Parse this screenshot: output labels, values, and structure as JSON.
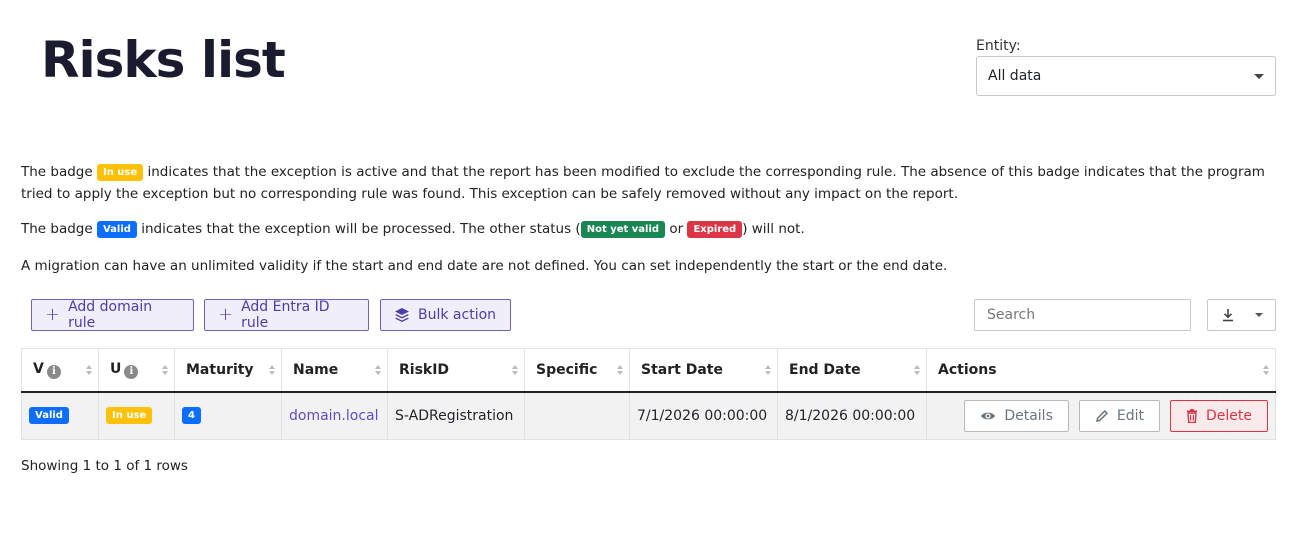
{
  "page": {
    "title": "Risks list"
  },
  "entity": {
    "label": "Entity:",
    "value": "All data"
  },
  "info": {
    "p1_a": "The badge",
    "p1_badge": "In use",
    "p1_b": "indicates that the exception is active and that the report has been modified to exclude the corresponding rule. The absence of this badge indicates that the program tried to apply the exception but no corresponding rule was found. This exception can be safely removed without any impact on the report.",
    "p2_a": "The badge",
    "p2_badge": "Valid",
    "p2_b": "indicates that the exception will be processed. The other status (",
    "p2_badge2": "Not yet valid",
    "p2_c": "or",
    "p2_badge3": "Expired",
    "p2_d": ") will not.",
    "p3": "A migration can have an unlimited validity if the start and end date are not defined. You can set independently the start or the end date."
  },
  "toolbar": {
    "add_domain": "Add domain rule",
    "add_entra": "Add Entra ID rule",
    "bulk": "Bulk action",
    "search_placeholder": "Search"
  },
  "table": {
    "headers": {
      "v": "V",
      "u": "U",
      "maturity": "Maturity",
      "name": "Name",
      "riskid": "RiskID",
      "specific": "Specific",
      "start": "Start Date",
      "end": "End Date",
      "actions": "Actions"
    },
    "rows": [
      {
        "v": "Valid",
        "u": "In use",
        "maturity": "4",
        "name": "domain.local",
        "riskid": "S-ADRegistration",
        "specific": "",
        "start": "7/1/2026 00:00:00",
        "end": "8/1/2026 00:00:00"
      }
    ],
    "actions": {
      "details": "Details",
      "edit": "Edit",
      "delete": "Delete"
    }
  },
  "footer": {
    "count": "Showing 1 to 1 of 1 rows"
  },
  "colors": {
    "accent": "#5b4fc4",
    "warning": "#ffc107",
    "primary": "#0d6efd",
    "success": "#198754",
    "danger": "#dc3545"
  }
}
